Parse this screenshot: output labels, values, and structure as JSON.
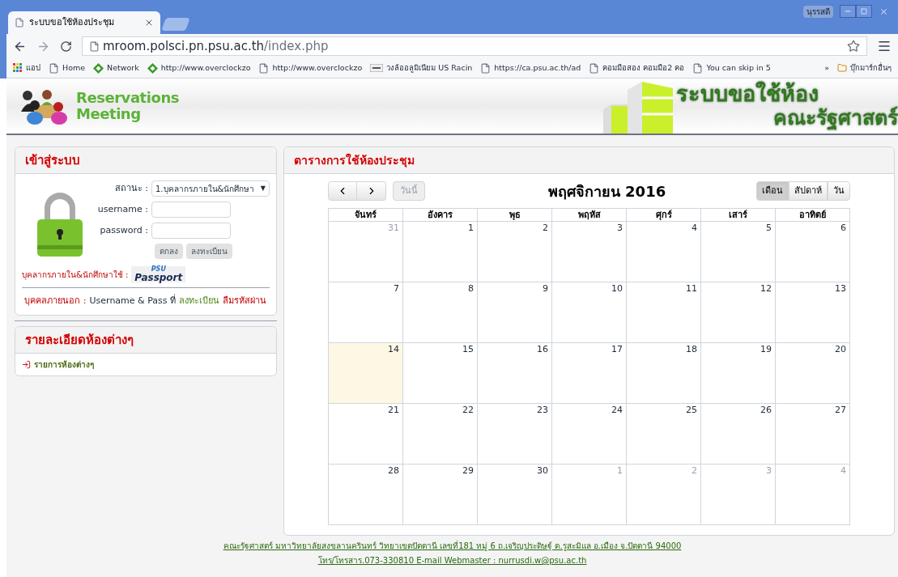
{
  "browser": {
    "tab_title": "ระบบขอใช้ห้องประชุม",
    "user": "นุรรสดี",
    "url_host": "mroom.polsci.pn.psu.ac.th",
    "url_path": "/index.php",
    "bookmarks": [
      {
        "kind": "apps",
        "label": "แอป"
      },
      {
        "kind": "page",
        "label": "Home"
      },
      {
        "kind": "diamond",
        "label": "Network"
      },
      {
        "kind": "diamond",
        "label": "http://www.overclockzo"
      },
      {
        "kind": "page",
        "label": "http://www.overclockzo"
      },
      {
        "kind": "uw",
        "label": "วงล้ออลูมิเนียม US Racin"
      },
      {
        "kind": "page",
        "label": "https://ca.psu.ac.th/ad"
      },
      {
        "kind": "page",
        "label": "คอมมือสอง คอมมือ2 คอ"
      },
      {
        "kind": "page",
        "label": "You can skip in 5"
      }
    ],
    "more": "»",
    "other_bookmarks": "บุ๊กมาร์กอื่นๆ"
  },
  "header": {
    "logo_line1": "Reservations",
    "logo_line2": "Meeting",
    "banner_line1": "ระบบขอใช้ห้อง",
    "banner_line2": "คณะรัฐศาสตร์"
  },
  "login": {
    "title": "เข้าสู่ระบบ",
    "status_label": "สถานะ :",
    "status_value": "1.บุคลากรภายใน&นักศึกษา",
    "status_caret": "▼",
    "username_label": "username :",
    "password_label": "password :",
    "buttons": [
      "ตกลง",
      "ลงทะเบียน"
    ],
    "passport_label": "บุคลากรภายใน&นักศึกษาใช้ :",
    "passport_top": "PSU",
    "passport_bottom": "Passport",
    "outsider_label": "บุคคลภายนอก :",
    "outsider_text": "Username & Pass ที่",
    "register_link": "ลงทะเบียน",
    "forgot_link": "ลืมรหัสผ่าน"
  },
  "rooms": {
    "title": "รายละเอียดห้องต่างๆ",
    "link": "รายการห้องต่างๆ"
  },
  "calendar": {
    "title": "ตารางการใช้ห้องประชุม",
    "today_button": "วันนี้",
    "today_disabled": true,
    "month": "พฤศจิกายน 2016",
    "views": [
      {
        "label": "เดือน",
        "selected": true
      },
      {
        "label": "สัปดาห์",
        "selected": false
      },
      {
        "label": "วัน",
        "selected": false
      }
    ],
    "weekdays": [
      "จันทร์",
      "อังคาร",
      "พุธ",
      "พฤหัส",
      "ศุกร์",
      "เสาร์",
      "อาทิตย์"
    ],
    "weeks": [
      [
        {
          "day": "31",
          "other": true,
          "today": false
        },
        {
          "day": "1",
          "other": false,
          "today": false
        },
        {
          "day": "2",
          "other": false,
          "today": false
        },
        {
          "day": "3",
          "other": false,
          "today": false
        },
        {
          "day": "4",
          "other": false,
          "today": false
        },
        {
          "day": "5",
          "other": false,
          "today": false
        },
        {
          "day": "6",
          "other": false,
          "today": false
        }
      ],
      [
        {
          "day": "7",
          "other": false,
          "today": false
        },
        {
          "day": "8",
          "other": false,
          "today": false
        },
        {
          "day": "9",
          "other": false,
          "today": false
        },
        {
          "day": "10",
          "other": false,
          "today": false
        },
        {
          "day": "11",
          "other": false,
          "today": false
        },
        {
          "day": "12",
          "other": false,
          "today": false
        },
        {
          "day": "13",
          "other": false,
          "today": false
        }
      ],
      [
        {
          "day": "14",
          "other": false,
          "today": true
        },
        {
          "day": "15",
          "other": false,
          "today": false
        },
        {
          "day": "16",
          "other": false,
          "today": false
        },
        {
          "day": "17",
          "other": false,
          "today": false
        },
        {
          "day": "18",
          "other": false,
          "today": false
        },
        {
          "day": "19",
          "other": false,
          "today": false
        },
        {
          "day": "20",
          "other": false,
          "today": false
        }
      ],
      [
        {
          "day": "21",
          "other": false,
          "today": false
        },
        {
          "day": "22",
          "other": false,
          "today": false
        },
        {
          "day": "23",
          "other": false,
          "today": false
        },
        {
          "day": "24",
          "other": false,
          "today": false
        },
        {
          "day": "25",
          "other": false,
          "today": false
        },
        {
          "day": "26",
          "other": false,
          "today": false
        },
        {
          "day": "27",
          "other": false,
          "today": false
        }
      ],
      [
        {
          "day": "28",
          "other": false,
          "today": false
        },
        {
          "day": "29",
          "other": false,
          "today": false
        },
        {
          "day": "30",
          "other": false,
          "today": false
        },
        {
          "day": "1",
          "other": true,
          "today": false
        },
        {
          "day": "2",
          "other": true,
          "today": false
        },
        {
          "day": "3",
          "other": true,
          "today": false
        },
        {
          "day": "4",
          "other": true,
          "today": false
        }
      ]
    ]
  },
  "footer": {
    "address": "คณะรัฐศาสตร์ มหาวิทยาลัยสงขลานครินทร์ วิทยาเขตปัตตานี เลขที่181 หมู่ 6 ถ.เจริญประดิษฐ์ ต.รูสะมิแล อ.เมือง จ.ปัตตานี 94000",
    "contact": "โทร/โทรสาร.073-330810 E-mail Webmaster : nurrusdi.w@psu.ac.th"
  }
}
